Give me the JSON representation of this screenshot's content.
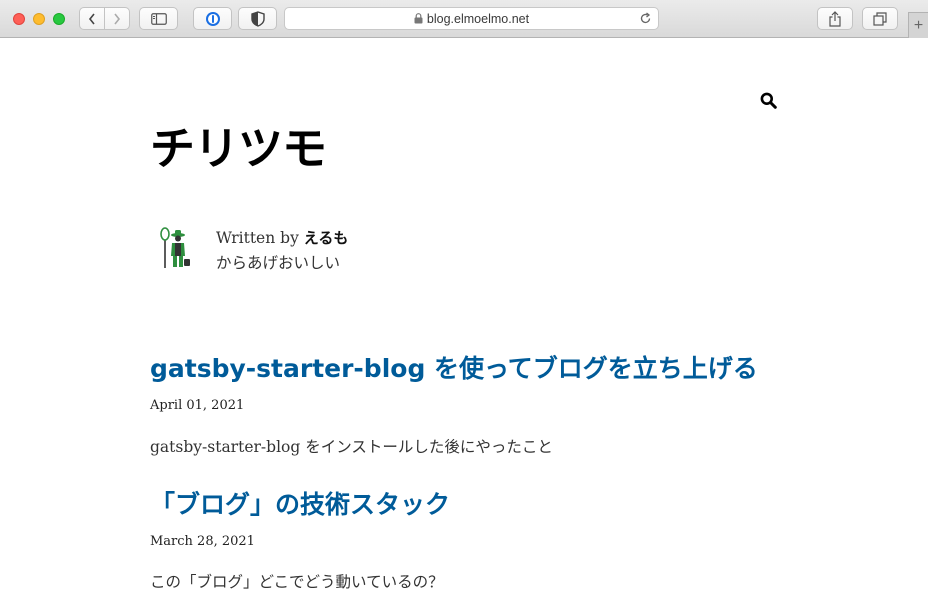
{
  "browser": {
    "url": "blog.elmoelmo.net",
    "new_tab_label": "+"
  },
  "icons": {
    "back": "chevron-left-icon",
    "forward": "chevron-right-icon",
    "sidebar": "sidebar-icon",
    "onepassword": "1password-icon",
    "shield": "shield-icon",
    "lock": "lock-icon",
    "reload": "reload-icon",
    "share": "share-icon",
    "tabs": "tab-overview-icon",
    "search": "search-icon"
  },
  "site": {
    "title": "チリツモ"
  },
  "bio": {
    "written_by": "Written by",
    "author": "えるも",
    "tagline": "からあげおいしい"
  },
  "posts": [
    {
      "title": "gatsby-starter-blog を使ってブログを立ち上げる",
      "date": "April 01, 2021",
      "description": "gatsby-starter-blog をインストールした後にやったこと"
    },
    {
      "title": "「ブログ」の技術スタック",
      "date": "March 28, 2021",
      "description": "この「ブログ」どこでどう動いているの？"
    }
  ],
  "colors": {
    "link": "#005b99",
    "title": "#000000",
    "text": "#333333"
  }
}
